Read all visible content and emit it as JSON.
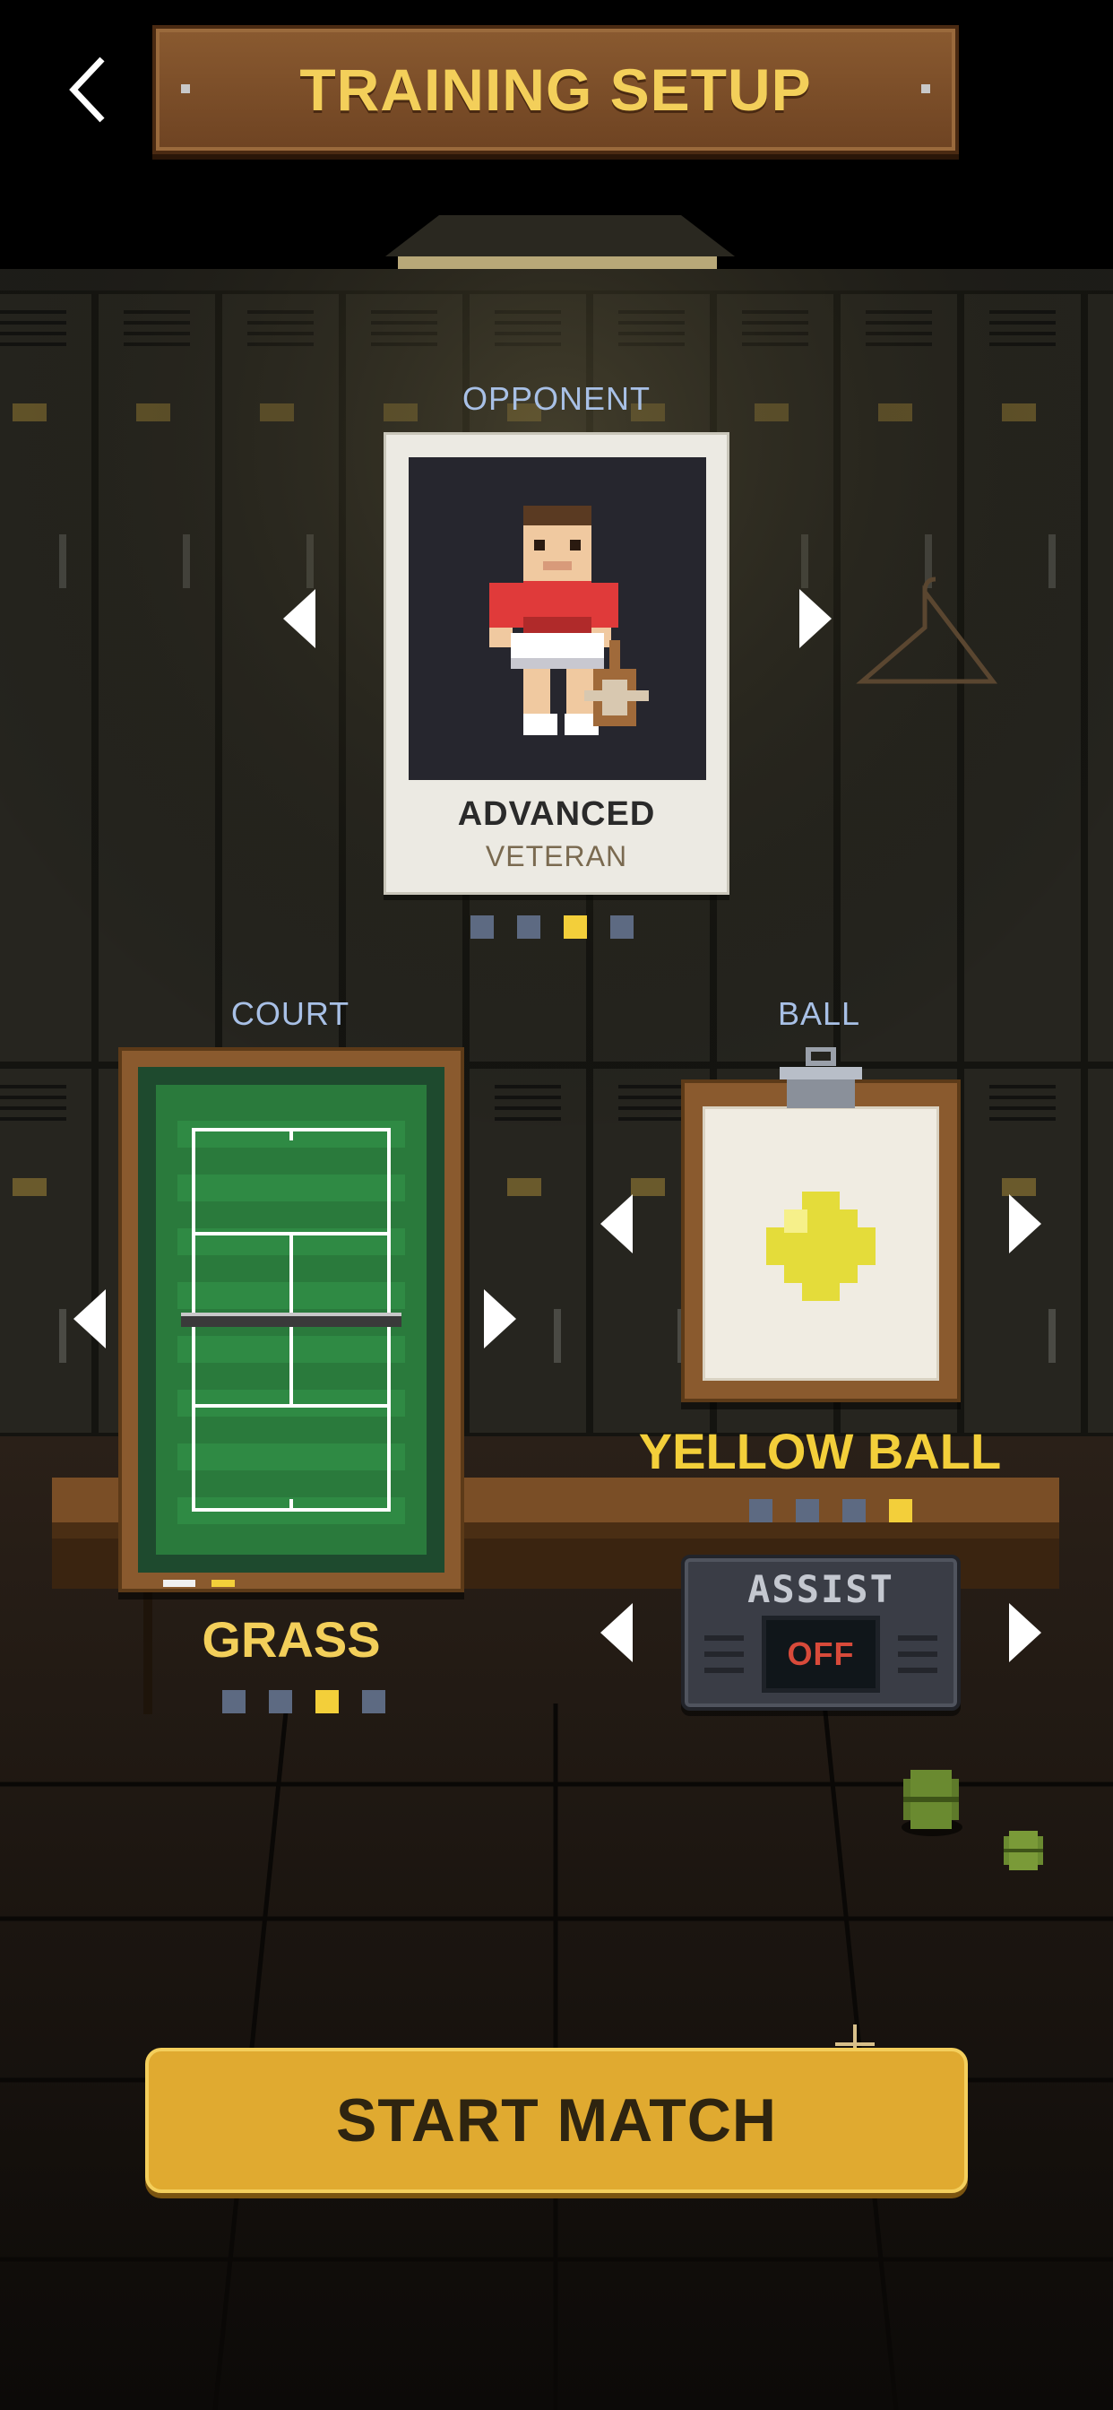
{
  "header": {
    "back_icon": "chevron-left-icon",
    "title": "TRAINING SETUP"
  },
  "opponent": {
    "label": "OPPONENT",
    "name": "ADVANCED",
    "subtitle": "VETERAN",
    "prev_icon": "triangle-left-icon",
    "next_icon": "triangle-right-icon",
    "page_count": 4,
    "selected_page": 3
  },
  "court": {
    "label": "COURT",
    "name": "GRASS",
    "page_count": 4,
    "selected_page": 3
  },
  "ball": {
    "label": "BALL",
    "name": "YELLOW BALL",
    "page_count": 4,
    "selected_page": 4,
    "color": "#e4dc3a"
  },
  "assist": {
    "title": "ASSIST",
    "value": "OFF"
  },
  "start_button": {
    "label": "START MATCH"
  },
  "colors": {
    "accent": "#f3cf3a",
    "button": "#e0aa30",
    "dot_active": "#f3cf3a",
    "dot_inactive": "#5d6a82",
    "label": "#a8c0e6"
  }
}
